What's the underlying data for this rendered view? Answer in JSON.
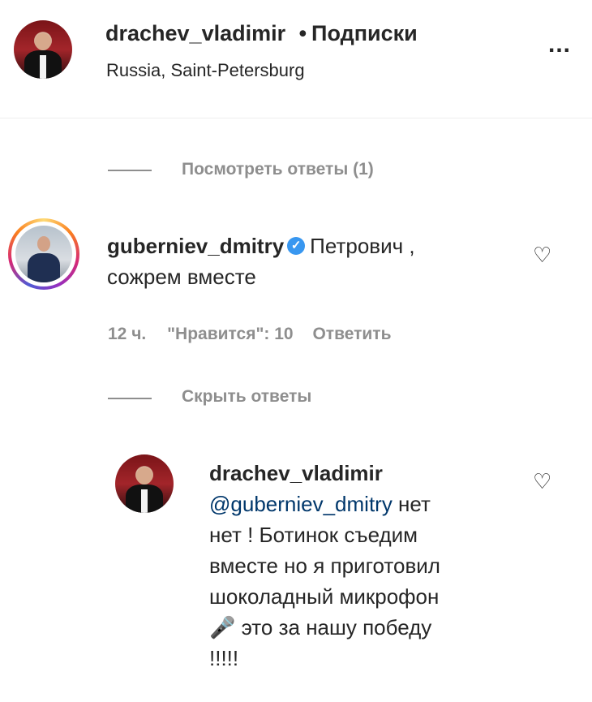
{
  "header": {
    "username": "drachev_vladimir",
    "separator": "•",
    "follow_status": "Подписки",
    "location": "Russia, Saint-Petersburg",
    "more_label": "..."
  },
  "thread": {
    "view_replies_label": "Посмотреть ответы (1)",
    "hide_replies_label": "Скрыть ответы"
  },
  "comment": {
    "username": "guberniev_dmitry",
    "verified_glyph": "✓",
    "text_line1": "Петрович ,",
    "text_line2": "сожрем вместе",
    "time": "12 ч.",
    "likes": "\"Нравится\": 10",
    "reply_label": "Ответить",
    "heart": "♡"
  },
  "reply": {
    "username": "drachev_vladimir",
    "mention": "@guberniev_dmitry",
    "line1_rest": " нет",
    "line2": "нет ! Ботинок съедим",
    "line3": "вместе но я приготовил",
    "line4": "шоколадный микрофон",
    "mic": "🎤",
    "line5_rest": " это за нашу победу",
    "line6": "!!!!!",
    "heart": "♡"
  },
  "icons": {
    "more": "more-options-icon",
    "heart": "heart-icon",
    "verified": "verified-badge-icon",
    "microphone": "microphone-emoji"
  },
  "colors": {
    "text": "#262626",
    "muted": "#8e8e8e",
    "mention": "#00376b",
    "verified": "#3897f0"
  }
}
